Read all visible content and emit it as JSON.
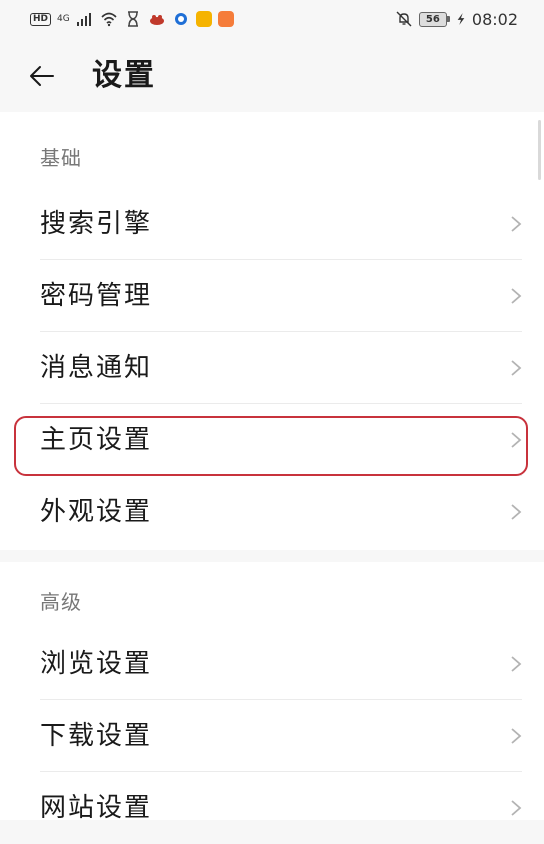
{
  "status_bar": {
    "network_badge": "HD",
    "network_type": "4G",
    "time": "08:02",
    "battery_level": "56",
    "apps": [
      {
        "icon": "hourglass-icon",
        "color": "#444444"
      },
      {
        "icon": "app-icon-red",
        "color": "#c0392b"
      },
      {
        "icon": "app-icon-blue-circle",
        "color": "#1f6fd6"
      },
      {
        "icon": "app-icon-yellow",
        "color": "#f5b300"
      },
      {
        "icon": "app-icon-orange",
        "color": "#f57c3a"
      }
    ]
  },
  "header": {
    "title": "设置"
  },
  "sections": [
    {
      "header": "基础",
      "items": [
        {
          "label": "搜索引擎"
        },
        {
          "label": "密码管理"
        },
        {
          "label": "消息通知"
        },
        {
          "label": "主页设置",
          "highlighted": true
        },
        {
          "label": "外观设置"
        }
      ]
    },
    {
      "header": "高级",
      "items": [
        {
          "label": "浏览设置"
        },
        {
          "label": "下载设置"
        },
        {
          "label": "网站设置"
        }
      ]
    }
  ],
  "colors": {
    "background": "#f7f7f7",
    "card": "#ffffff",
    "highlight_border": "#c8323c",
    "section_header": "#777777",
    "chevron": "#b3b3b3"
  }
}
